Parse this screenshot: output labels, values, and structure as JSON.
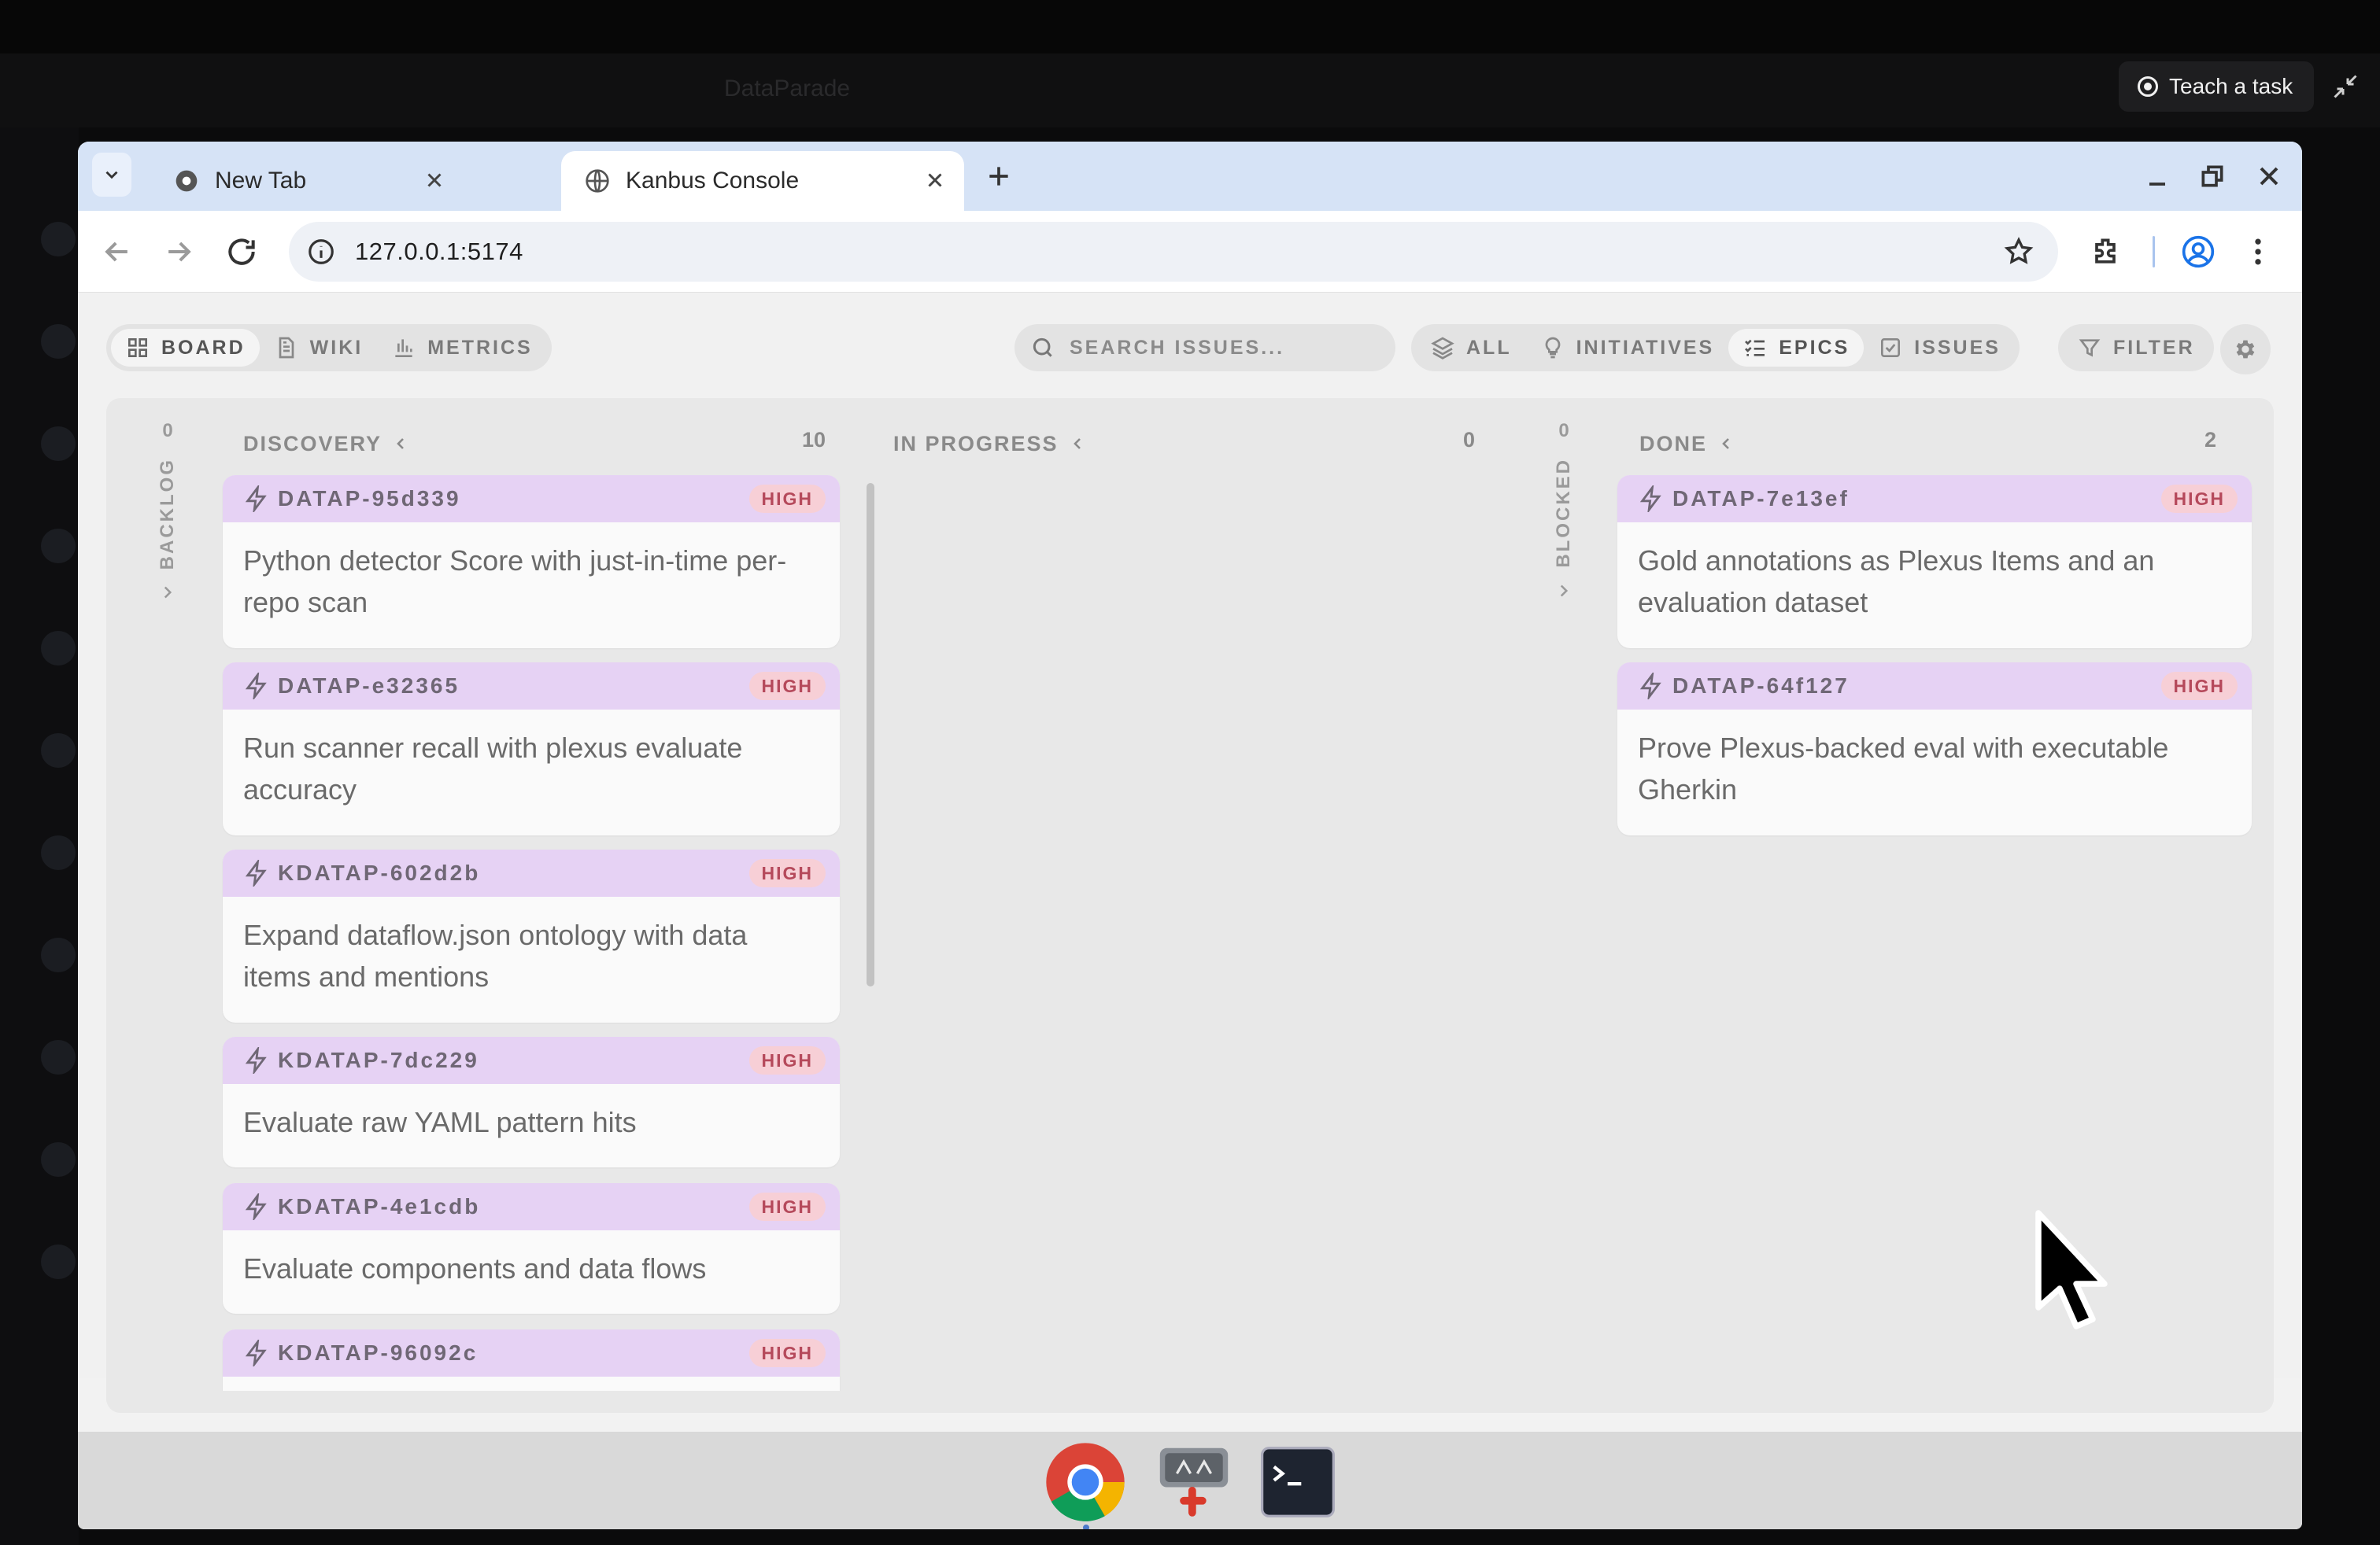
{
  "host": {
    "teach_label": "Teach a task",
    "faded_title": "DataParade"
  },
  "browser": {
    "tabs": [
      {
        "label": "New Tab",
        "active": false
      },
      {
        "label": "Kanbus Console",
        "active": true
      }
    ],
    "url": "127.0.0.1:5174"
  },
  "app": {
    "view_tabs": [
      {
        "label": "BOARD",
        "icon": "grid-icon",
        "active": true
      },
      {
        "label": "WIKI",
        "icon": "document-icon",
        "active": false
      },
      {
        "label": "METRICS",
        "icon": "bar-chart-icon",
        "active": false
      }
    ],
    "search_placeholder": "SEARCH ISSUES...",
    "type_filters": [
      {
        "label": "ALL",
        "icon": "layers-icon",
        "active": false
      },
      {
        "label": "INITIATIVES",
        "icon": "lightbulb-icon",
        "active": false
      },
      {
        "label": "EPICS",
        "icon": "checklist-icon",
        "active": true
      },
      {
        "label": "ISSUES",
        "icon": "checkbox-icon",
        "active": false
      }
    ],
    "filter_label": "FILTER",
    "board": {
      "backlog": {
        "label": "BACKLOG",
        "count": "0"
      },
      "blocked": {
        "label": "BLOCKED",
        "count": "0"
      },
      "columns": [
        {
          "label": "DISCOVERY",
          "count": "10",
          "cards": [
            {
              "id": "DATAP-95d339",
              "priority": "HIGH",
              "title": "Python detector Score with just-in-time per-repo scan"
            },
            {
              "id": "DATAP-e32365",
              "priority": "HIGH",
              "title": "Run scanner recall with plexus evaluate accuracy"
            },
            {
              "id": "KDATAP-602d2b",
              "priority": "HIGH",
              "title": "Expand dataflow.json ontology with data items and mentions"
            },
            {
              "id": "KDATAP-7dc229",
              "priority": "HIGH",
              "title": "Evaluate raw YAML pattern hits"
            },
            {
              "id": "KDATAP-4e1cdb",
              "priority": "HIGH",
              "title": "Evaluate components and data flows"
            },
            {
              "id": "KDATAP-96092c",
              "priority": "HIGH",
              "title": ""
            }
          ]
        },
        {
          "label": "IN PROGRESS",
          "count": "0",
          "cards": []
        },
        {
          "label": "DONE",
          "count": "2",
          "cards": [
            {
              "id": "DATAP-7e13ef",
              "priority": "HIGH",
              "title": "Gold annotations as Plexus Items and an evaluation dataset"
            },
            {
              "id": "DATAP-64f127",
              "priority": "HIGH",
              "title": "Prove Plexus-backed eval with executable Gherkin"
            }
          ]
        }
      ]
    }
  },
  "dock": {
    "apps": [
      "chrome-icon",
      "automator-icon",
      "terminal-icon"
    ]
  },
  "colors": {
    "card_header": "#e6d2f4",
    "priority_bg": "#f7cfd6",
    "priority_text": "#b5495b",
    "tabbar": "#d6e3f6"
  }
}
